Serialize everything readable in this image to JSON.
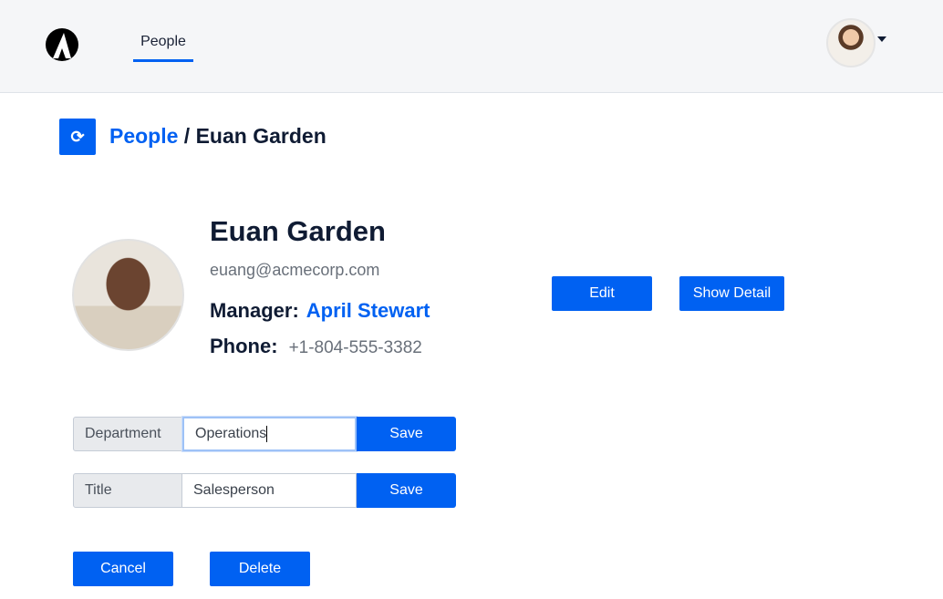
{
  "nav": {
    "tab": "People"
  },
  "breadcrumb": {
    "parent": "People",
    "separator": " / ",
    "current": "Euan Garden"
  },
  "profile": {
    "name": "Euan Garden",
    "email": "euang@acmecorp.com",
    "manager_label": "Manager:",
    "manager": "April Stewart",
    "phone_label": "Phone:",
    "phone": "+1-804-555-3382"
  },
  "actions": {
    "edit": "Edit",
    "show_detail": "Show Detail",
    "cancel": "Cancel",
    "delete": "Delete"
  },
  "fields": [
    {
      "label": "Department",
      "value": "Operations",
      "save": "Save"
    },
    {
      "label": "Title",
      "value": "Salesperson",
      "save": "Save"
    }
  ],
  "colors": {
    "accent": "#0061f2"
  }
}
